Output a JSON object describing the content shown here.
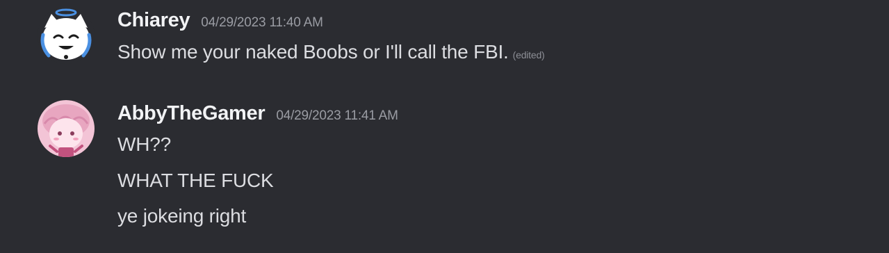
{
  "messages": [
    {
      "author": "Chiarey",
      "timestamp": "04/29/2023 11:40 AM",
      "avatar_icon": "cat-face-avatar",
      "lines": [
        {
          "text": "Show me your naked Boobs or I'll call the FBI.",
          "edited_label": "(edited)"
        }
      ]
    },
    {
      "author": "AbbyTheGamer",
      "timestamp": "04/29/2023 11:41 AM",
      "avatar_icon": "pink-anime-avatar",
      "lines": [
        {
          "text": "WH??"
        },
        {
          "text": "WHAT THE FUCK"
        },
        {
          "text": "ye jokeing right"
        }
      ]
    }
  ],
  "colors": {
    "background": "#2b2c31",
    "author_text": "#f2f3f5",
    "timestamp_text": "#9a9ca3",
    "message_text": "#dcdde1"
  }
}
